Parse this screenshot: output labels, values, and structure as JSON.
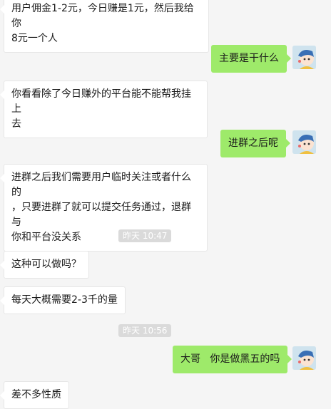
{
  "colors": {
    "background": "#f5f5f5",
    "self_bubble": "#9eea6a",
    "other_bubble": "#ffffff",
    "timestamp_bg": "#dadada"
  },
  "messages": [
    {
      "side": "left",
      "text": "用户佣金1-2元，今日赚是1元，然后我给你\n8元一个人"
    },
    {
      "side": "right",
      "text": "主要是干什么"
    },
    {
      "side": "left",
      "text": "你看看除了今日赚外的平台能不能帮我挂上\n去"
    },
    {
      "side": "right",
      "text": "进群之后呢"
    },
    {
      "side": "left",
      "text": "进群之后我们需要用户临时关注或者什么的\n，只要进群了就可以提交任务通过，退群与\n你和平台没关系"
    },
    {
      "side": "time",
      "text": "昨天 10:47"
    },
    {
      "side": "left",
      "text": "这种可以做吗？"
    },
    {
      "side": "left",
      "text": "每天大概需要2-3千的量"
    },
    {
      "side": "time",
      "text": "昨天 10:56"
    },
    {
      "side": "right",
      "text": "大哥   你是做黑五的吗"
    },
    {
      "side": "left",
      "text": "差不多性质"
    }
  ],
  "self_avatar_icon": "cartoon-avatar-icon"
}
